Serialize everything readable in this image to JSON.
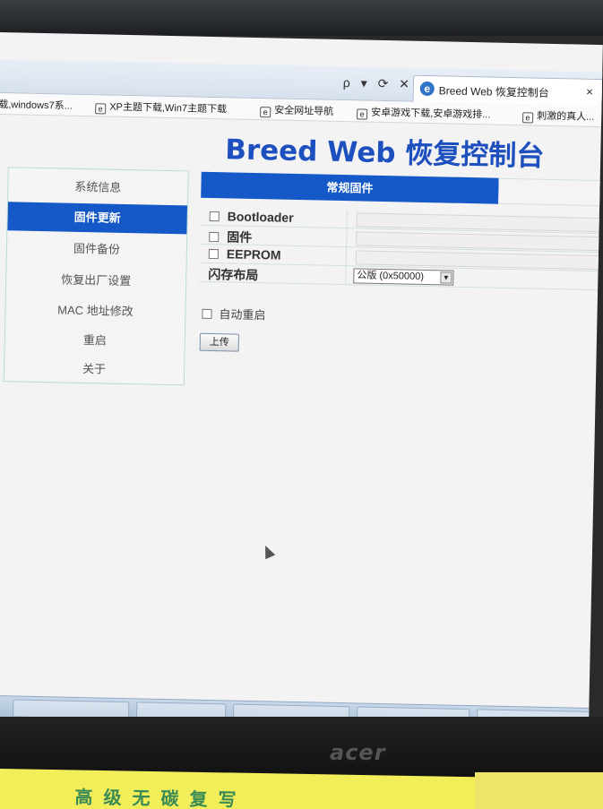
{
  "browser": {
    "address_controls": "ρ ▾ ⟳ ✕",
    "tab": {
      "icon": "ie-icon",
      "title": "Breed Web 恢复控制台",
      "close": "×"
    },
    "favorites": [
      {
        "label": "载,windows7系..."
      },
      {
        "label": "XP主题下载,Win7主题下载"
      },
      {
        "label": "安全网址导航"
      },
      {
        "label": "安卓游戏下载,安卓游戏排..."
      },
      {
        "label": "刺激的真人..."
      }
    ]
  },
  "page": {
    "title": "Breed Web 恢复控制台"
  },
  "sidebar": {
    "items": [
      {
        "label": "系统信息",
        "active": false
      },
      {
        "label": "固件更新",
        "active": true
      },
      {
        "label": "固件备份",
        "active": false
      },
      {
        "label": "恢复出厂设置",
        "active": false
      },
      {
        "label": "MAC 地址修改",
        "active": false
      },
      {
        "label": "重启",
        "active": false
      },
      {
        "label": "关于",
        "active": false
      }
    ]
  },
  "main": {
    "section_header": "常规固件",
    "rows": [
      {
        "label": "Bootloader",
        "checked": false
      },
      {
        "label": "固件",
        "checked": false
      },
      {
        "label": "EEPROM",
        "checked": false
      }
    ],
    "flash_layout": {
      "label": "闪存布局",
      "selected": "公版 (0x50000)"
    },
    "auto_reboot_label": "自动重启",
    "upload_label": "上传"
  },
  "monitor": {
    "brand": "acer",
    "sticker_text": "高级无碳复写"
  },
  "colors": {
    "accent": "#1558c8",
    "title": "#1d4fbf",
    "border": "#cfe2dc"
  }
}
